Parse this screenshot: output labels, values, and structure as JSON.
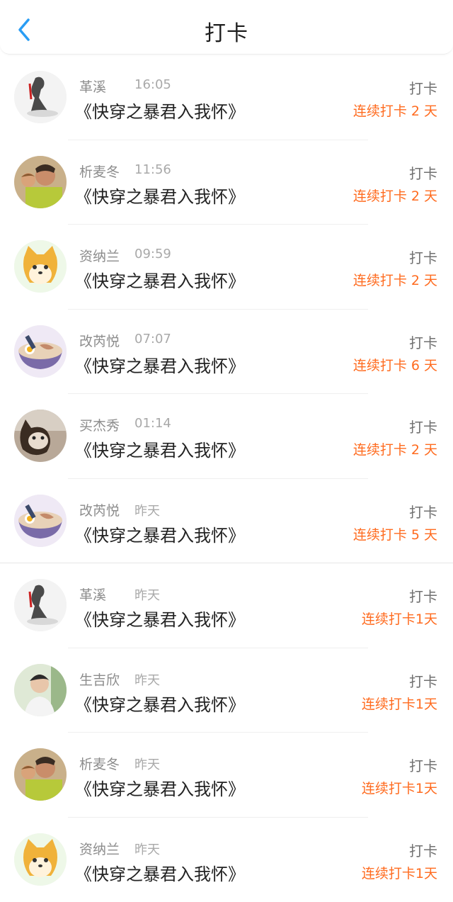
{
  "header": {
    "title": "打卡",
    "accent_color": "#2a9df4"
  },
  "colors": {
    "streak": "#ff6b1f",
    "name": "#8c8c8c",
    "time": "#a9a9a9",
    "book": "#222222"
  },
  "rows": [
    {
      "name": "革溪",
      "time": "16:05",
      "book": "《快穿之暴君入我怀》",
      "tag": "打卡",
      "streak": "连续打卡 2 天",
      "avatar": "ink-girl"
    },
    {
      "name": "析麦冬",
      "time": "11:56",
      "book": "《快穿之暴君入我怀》",
      "tag": "打卡",
      "streak": "连续打卡 2 天",
      "avatar": "man-photo"
    },
    {
      "name": "资纳兰",
      "time": "09:59",
      "book": "《快穿之暴君入我怀》",
      "tag": "打卡",
      "streak": "连续打卡 2 天",
      "avatar": "shiba-dog"
    },
    {
      "name": "改芮悦",
      "time": "07:07",
      "book": "《快穿之暴君入我怀》",
      "tag": "打卡",
      "streak": "连续打卡 6 天",
      "avatar": "ramen-bowl"
    },
    {
      "name": "买杰秀",
      "time": "01:14",
      "book": "《快穿之暴君入我怀》",
      "tag": "打卡",
      "streak": "连续打卡 2 天",
      "avatar": "cat-photo"
    },
    {
      "name": "改芮悦",
      "time": "昨天",
      "book": "《快穿之暴君入我怀》",
      "tag": "打卡",
      "streak": "连续打卡 5 天",
      "avatar": "ramen-bowl"
    },
    {
      "name": "革溪",
      "time": "昨天",
      "book": "《快穿之暴君入我怀》",
      "tag": "打卡",
      "streak": "连续打卡1天",
      "avatar": "ink-girl"
    },
    {
      "name": "生吉欣",
      "time": "昨天",
      "book": "《快穿之暴君入我怀》",
      "tag": "打卡",
      "streak": "连续打卡1天",
      "avatar": "boy-photo"
    },
    {
      "name": "析麦冬",
      "time": "昨天",
      "book": "《快穿之暴君入我怀》",
      "tag": "打卡",
      "streak": "连续打卡1天",
      "avatar": "man-photo"
    },
    {
      "name": "资纳兰",
      "time": "昨天",
      "book": "《快穿之暴君入我怀》",
      "tag": "打卡",
      "streak": "连续打卡1天",
      "avatar": "shiba-dog"
    }
  ]
}
